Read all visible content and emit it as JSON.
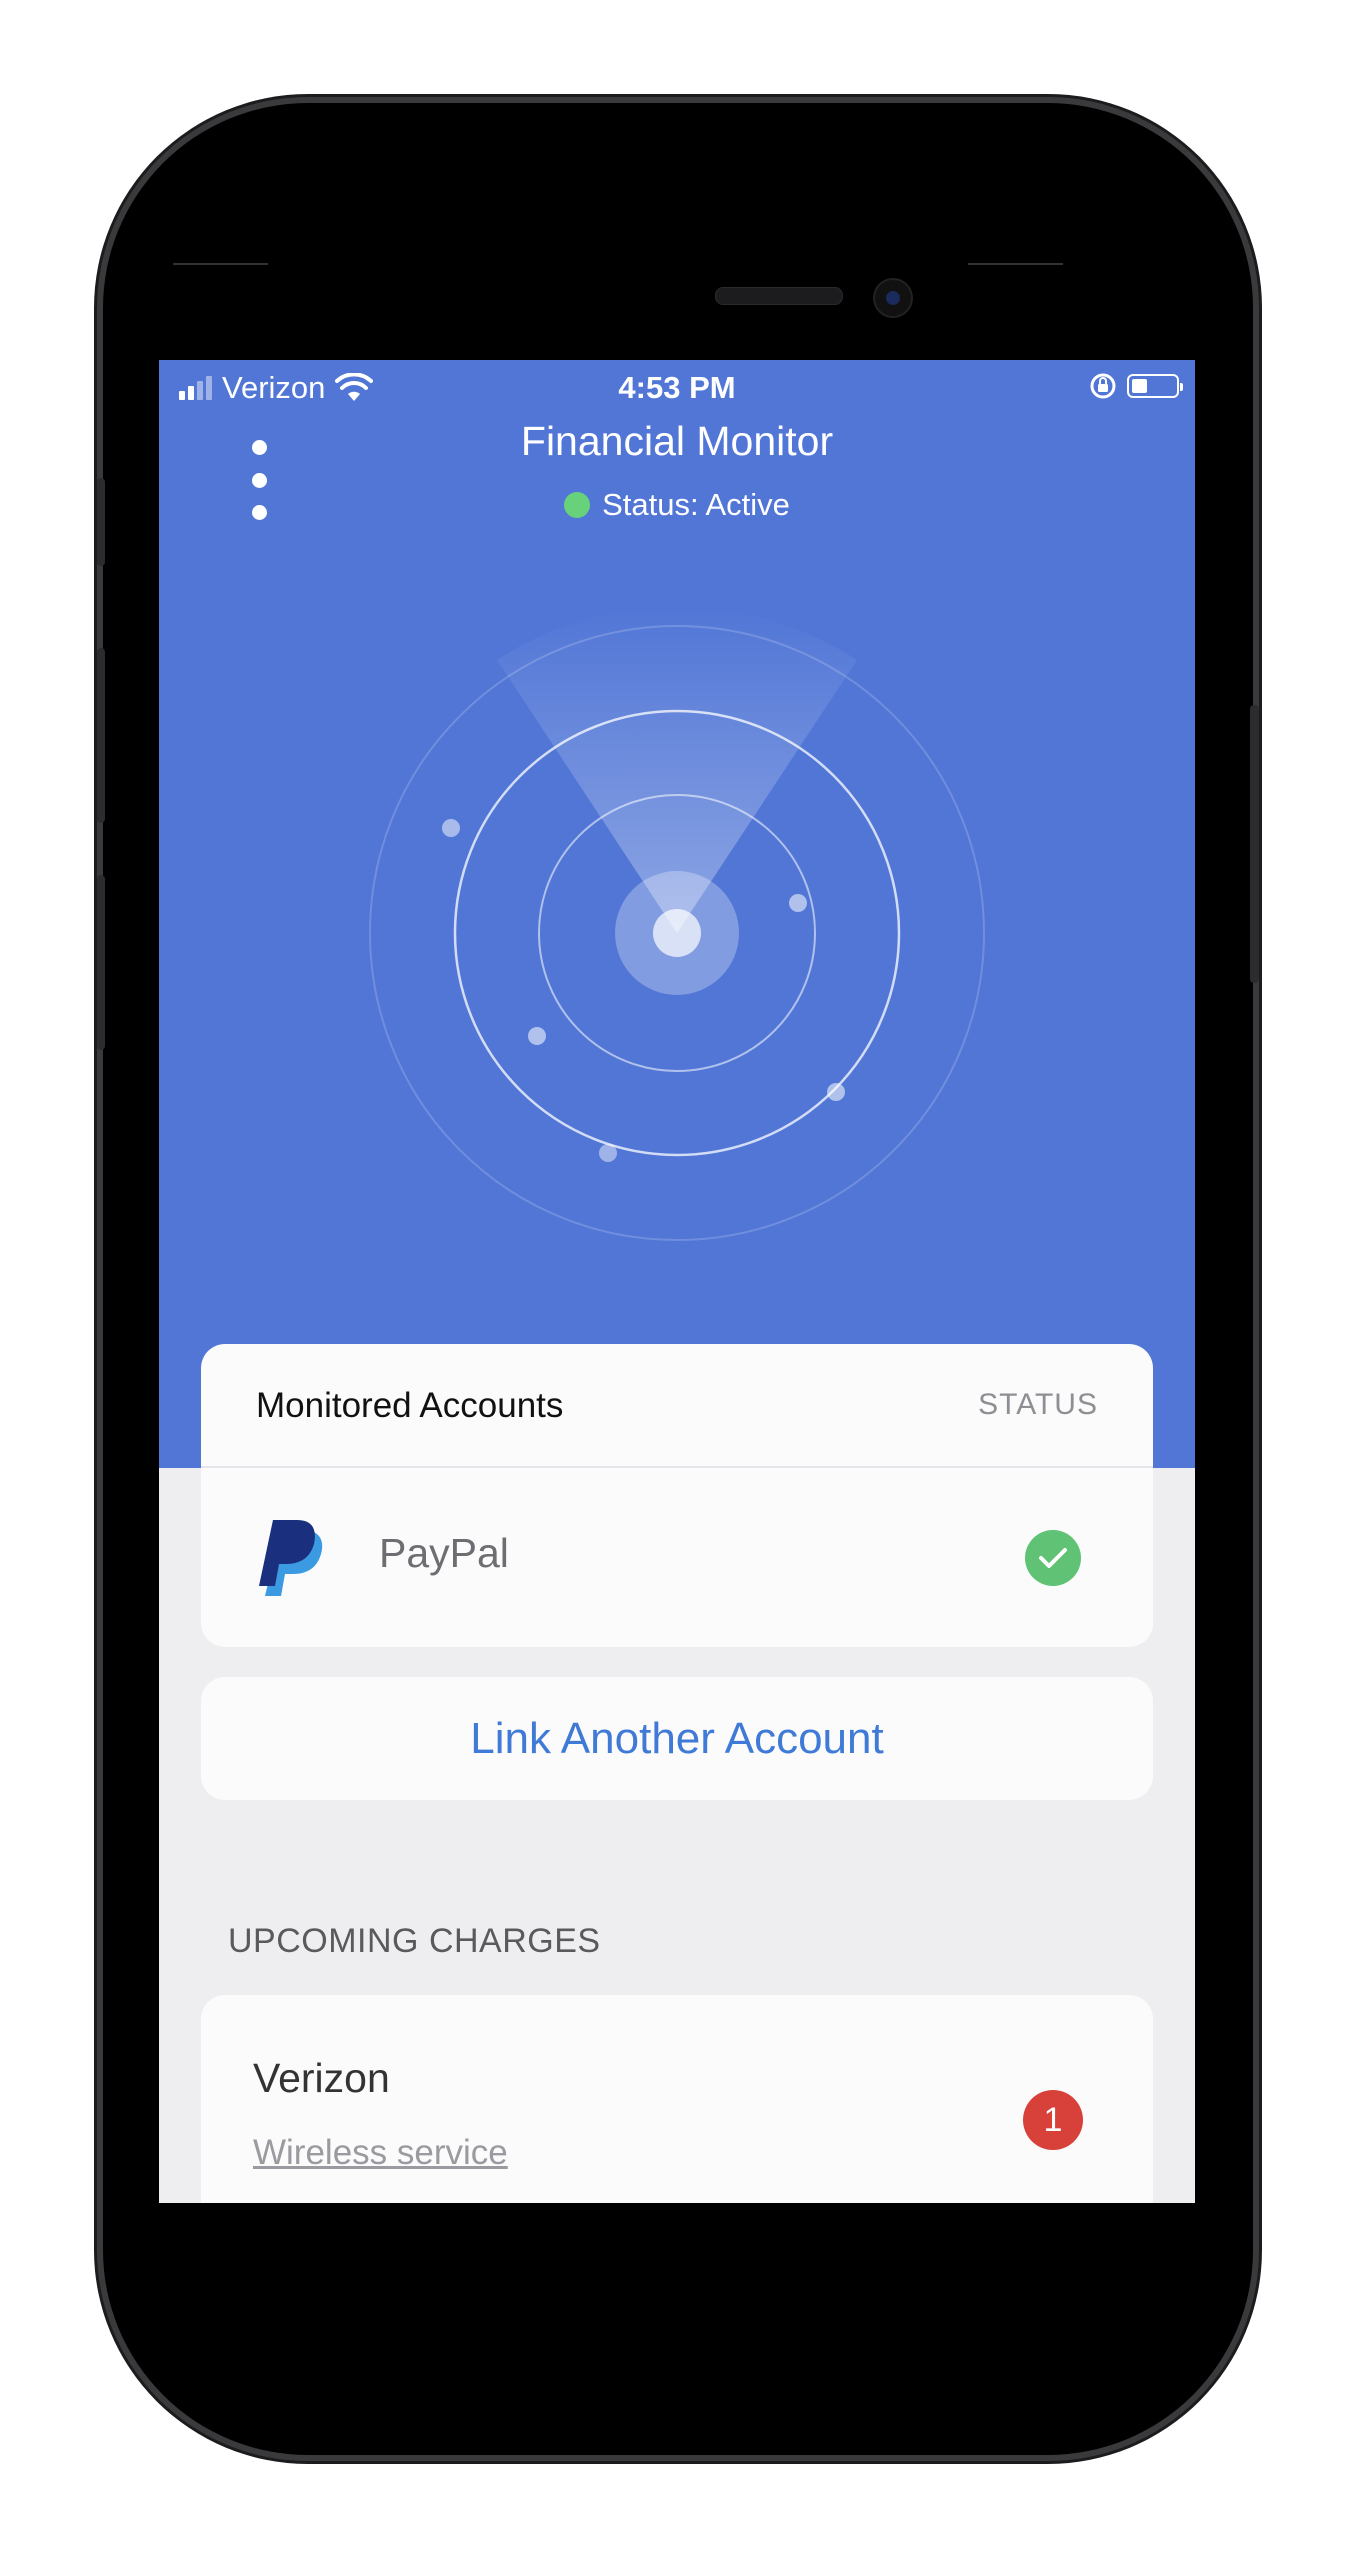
{
  "status_bar": {
    "carrier": "Verizon",
    "time": "4:53 PM",
    "icons": [
      "signal-icon",
      "wifi-icon",
      "rotation-lock-icon",
      "battery-icon"
    ]
  },
  "header": {
    "title": "Financial Monitor",
    "status_text": "Status: Active",
    "status_color": "#67d27a",
    "menu_icon": "more-vertical-icon"
  },
  "accent": "#5176d6",
  "monitored_accounts": {
    "title": "Monitored Accounts",
    "status_header": "STATUS",
    "items": [
      {
        "name": "PayPal",
        "logo": "paypal-logo-icon",
        "status_icon": "checkmark-icon",
        "status_color": "#60c274"
      }
    ]
  },
  "link_account": {
    "label": "Link Another Account",
    "color": "#3f7ad6"
  },
  "upcoming_charges": {
    "section_label": "UPCOMING CHARGES",
    "items": [
      {
        "title": "Verizon",
        "subtitle": "Wireless service",
        "badge": "1",
        "badge_color": "#d8403a"
      }
    ]
  }
}
